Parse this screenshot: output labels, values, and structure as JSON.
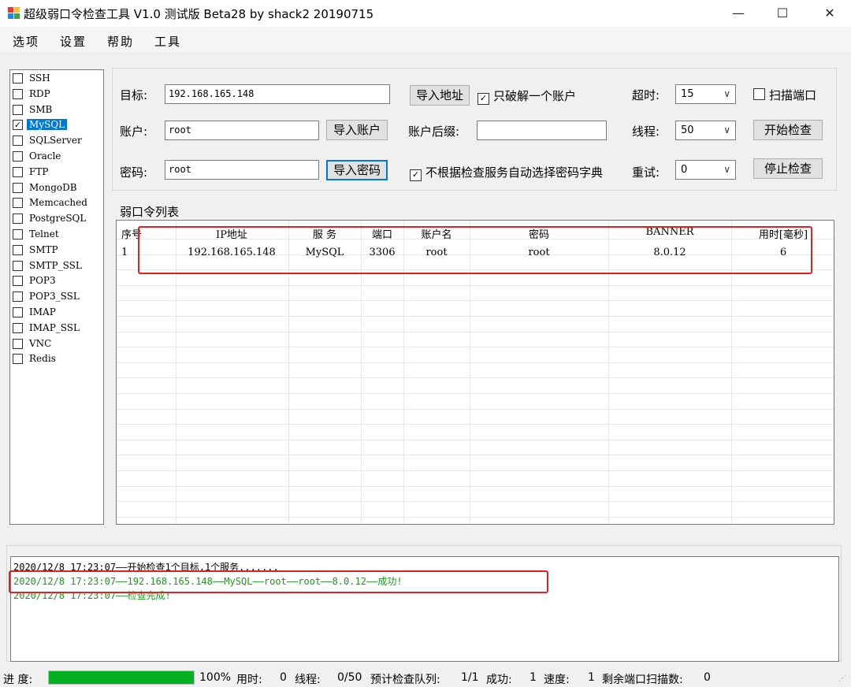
{
  "window": {
    "title": "超级弱口令检查工具 V1.0 测试版 Beta28 by shack2 20190715",
    "minimize": "—",
    "maximize": "☐",
    "close": "✕"
  },
  "menu": [
    "选项",
    "设置",
    "帮助",
    "工具"
  ],
  "services": [
    {
      "label": "SSH",
      "checked": false
    },
    {
      "label": "RDP",
      "checked": false
    },
    {
      "label": "SMB",
      "checked": false
    },
    {
      "label": "MySQL",
      "checked": true,
      "selected": true
    },
    {
      "label": "SQLServer",
      "checked": false
    },
    {
      "label": "Oracle",
      "checked": false
    },
    {
      "label": "FTP",
      "checked": false
    },
    {
      "label": "MongoDB",
      "checked": false
    },
    {
      "label": "Memcached",
      "checked": false
    },
    {
      "label": "PostgreSQL",
      "checked": false
    },
    {
      "label": "Telnet",
      "checked": false
    },
    {
      "label": "SMTP",
      "checked": false
    },
    {
      "label": "SMTP_SSL",
      "checked": false
    },
    {
      "label": "POP3",
      "checked": false
    },
    {
      "label": "POP3_SSL",
      "checked": false
    },
    {
      "label": "IMAP",
      "checked": false
    },
    {
      "label": "IMAP_SSL",
      "checked": false
    },
    {
      "label": "VNC",
      "checked": false
    },
    {
      "label": "Redis",
      "checked": false
    }
  ],
  "config": {
    "target_label": "目标:",
    "target_value": "192.168.165.148",
    "import_address": "导入地址",
    "only_one_account": "只破解一个账户",
    "only_one_account_checked": true,
    "timeout_label": "超时:",
    "timeout_value": "15",
    "scan_port": "扫描端口",
    "scan_port_checked": false,
    "account_label": "账户:",
    "account_value": "root",
    "import_account": "导入账户",
    "account_suffix_label": "账户后缀:",
    "account_suffix_value": "",
    "threads_label": "线程:",
    "threads_value": "50",
    "start_check": "开始检查",
    "password_label": "密码:",
    "password_value": "root",
    "import_password": "导入密码",
    "auto_dict": "不根据检查服务自动选择密码字典",
    "auto_dict_checked": true,
    "retry_label": "重试:",
    "retry_value": "0",
    "stop_check": "停止检查"
  },
  "grid": {
    "title": "弱口令列表",
    "columns": [
      "序号",
      "IP地址",
      "服 务",
      "端口",
      "账户名",
      "密码",
      "BANNER",
      "用时[毫秒]"
    ],
    "rows": [
      [
        "1",
        "192.168.165.148",
        "MySQL",
        "3306",
        "root",
        "root",
        "8.0.12",
        "6"
      ]
    ]
  },
  "log": [
    {
      "text": "2020/12/8 17:23:07——开始检查1个目标,1个服务.......",
      "color": "#000000"
    },
    {
      "text": "2020/12/8 17:23:07——192.168.165.148——MySQL——root——root——8.0.12——成功!",
      "color": "#1a9a1a"
    },
    {
      "text": "2020/12/8 17:23:07——检查完成!",
      "color": "#1a9a1a"
    }
  ],
  "status": {
    "progress_label": "进 度:",
    "progress_percent": 100,
    "progress_text": "100%",
    "elapsed_label": "用时:",
    "elapsed_value": "0",
    "threads_label": "线程:",
    "threads_value": "0/50",
    "queue_label": "预计检查队列:",
    "queue_value": "1/1",
    "success_label": "成功:",
    "success_value": "1",
    "speed_label": "速度:",
    "speed_value": "1",
    "remaining_label": "剩余端口扫描数:",
    "remaining_value": "0"
  },
  "colors": {
    "accent": "#0078d7",
    "highlight_red": "#e52020",
    "progress_green": "#06b025",
    "success_green": "#1a9a1a"
  }
}
